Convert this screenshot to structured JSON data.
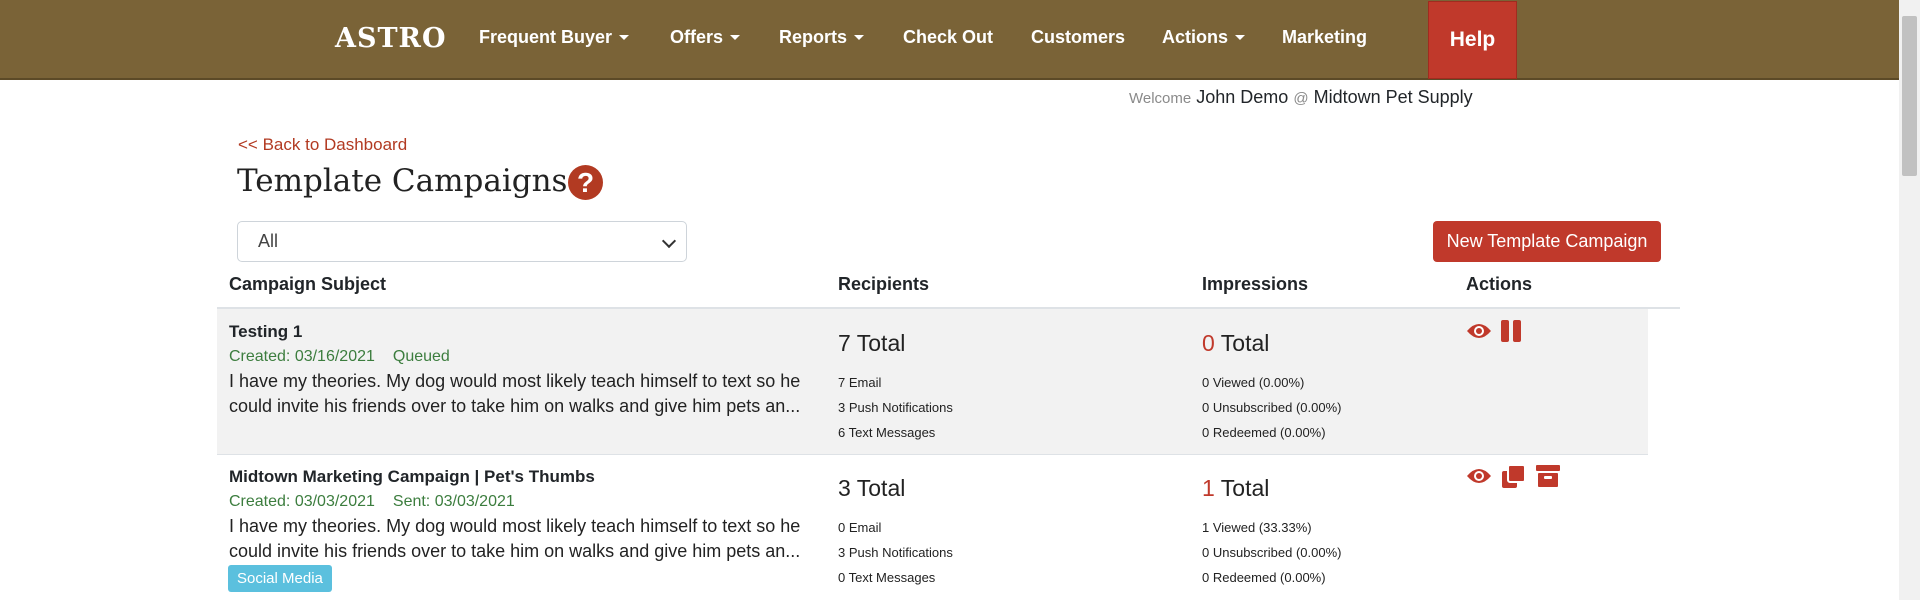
{
  "nav": {
    "brand": "ASTRO",
    "items": [
      {
        "label": "Frequent Buyer",
        "dropdown": true
      },
      {
        "label": "Offers",
        "dropdown": true
      },
      {
        "label": "Reports",
        "dropdown": true
      },
      {
        "label": "Check Out",
        "dropdown": false
      },
      {
        "label": "Customers",
        "dropdown": false
      },
      {
        "label": "Actions",
        "dropdown": true
      },
      {
        "label": "Marketing",
        "dropdown": false
      }
    ],
    "help_label": "Help"
  },
  "welcome": {
    "prefix": "Welcome",
    "user": "John Demo",
    "at": "@",
    "store": "Midtown Pet Supply"
  },
  "back_link": "<< Back to Dashboard",
  "page_title": "Template Campaigns",
  "filter": {
    "selected": "All"
  },
  "new_button": "New Template Campaign",
  "table": {
    "headers": [
      "Campaign Subject",
      "Recipients",
      "Impressions",
      "Actions"
    ],
    "rows": [
      {
        "subject": "Testing 1",
        "created": "Created: 03/16/2021",
        "status": "Queued",
        "desc_line1": "I have my theories. My dog would most likely teach himself to text so he",
        "desc_line2": "could invite his friends over to take him on walks and give him pets an...",
        "recipients_total": "7 Total",
        "recipients": [
          "7 Email",
          "3 Push Notifications",
          "6 Text Messages"
        ],
        "impressions_count": "0",
        "impressions_total_label": "Total",
        "impressions": [
          "0 Viewed (0.00%)",
          "0 Unsubscribed (0.00%)",
          "0 Redeemed (0.00%)"
        ],
        "actions": [
          "eye-icon",
          "pause-icon"
        ]
      },
      {
        "subject": "Midtown Marketing Campaign | Pet's Thumbs",
        "created": "Created: 03/03/2021",
        "status": "Sent: 03/03/2021",
        "desc_line1": "I have my theories. My dog would most likely teach himself to text so he",
        "desc_line2": "could invite his friends over to take him on walks and give him pets an...",
        "tag": "Social Media",
        "recipients_total": "3 Total",
        "recipients": [
          "0 Email",
          "3 Push Notifications",
          "0 Text Messages"
        ],
        "impressions_count": "1",
        "impressions_total_label": "Total",
        "impressions": [
          "1 Viewed (33.33%)",
          "0 Unsubscribed (0.00%)",
          "0 Redeemed (0.00%)"
        ],
        "actions": [
          "eye-icon",
          "copy-icon",
          "archive-icon"
        ]
      }
    ]
  },
  "colors": {
    "navbar": "#7a6337",
    "accent": "#c0392b",
    "success_text": "#3c7d3e",
    "tag": "#5bc0de"
  }
}
